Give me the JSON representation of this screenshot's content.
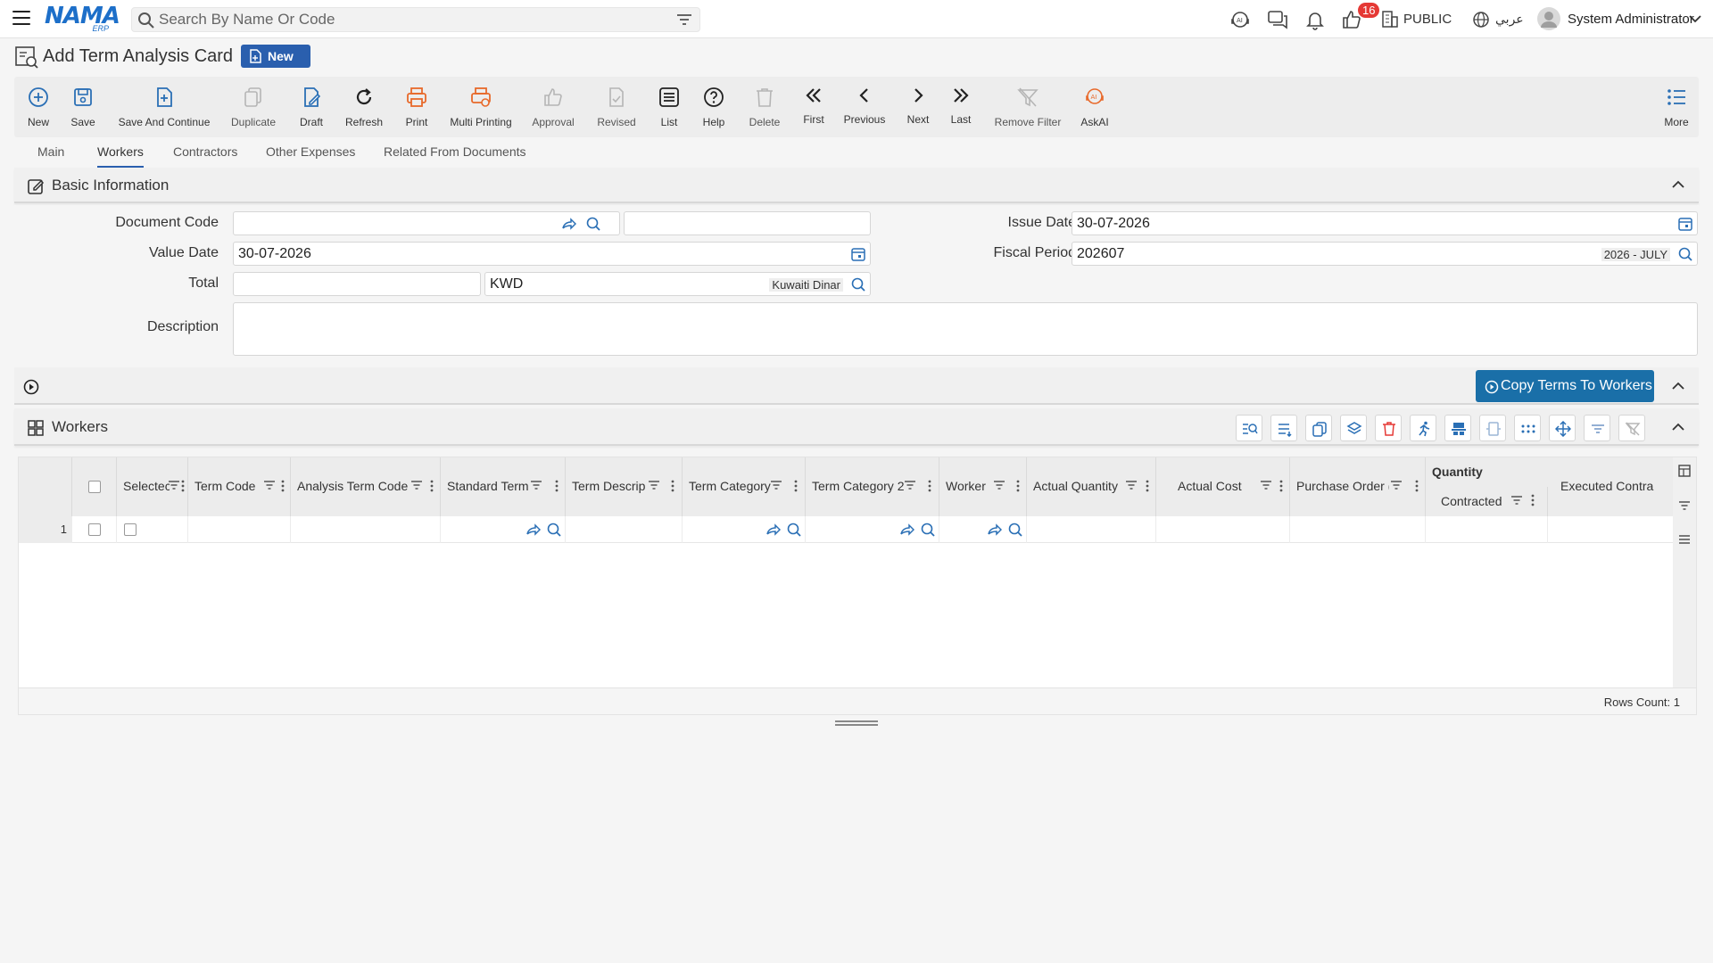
{
  "topbar": {
    "search_placeholder": "Search By Name Or Code",
    "logo_main": "NAMA",
    "logo_sub": "ERP",
    "notification_count": "16",
    "branch": "PUBLIC",
    "language": "عربي",
    "user_name": "System Administrator"
  },
  "page": {
    "title": "Add Term Analysis Card",
    "status_badge": "New"
  },
  "toolbar": [
    {
      "label": "New",
      "icon": "plus-circle-icon"
    },
    {
      "label": "Save",
      "icon": "save-icon"
    },
    {
      "label": "Save And Continue",
      "icon": "save-continue-icon"
    },
    {
      "label": "Duplicate",
      "icon": "duplicate-icon"
    },
    {
      "label": "Draft",
      "icon": "draft-icon"
    },
    {
      "label": "Refresh",
      "icon": "refresh-icon"
    },
    {
      "label": "Print",
      "icon": "print-icon"
    },
    {
      "label": "Multi Printing",
      "icon": "multi-print-icon"
    },
    {
      "label": "Approval",
      "icon": "thumbs-up-icon"
    },
    {
      "label": "Revised",
      "icon": "revised-icon"
    },
    {
      "label": "List",
      "icon": "list-icon"
    },
    {
      "label": "Help",
      "icon": "help-icon"
    },
    {
      "label": "Delete",
      "icon": "trash-icon"
    },
    {
      "label": "First",
      "icon": "first-icon"
    },
    {
      "label": "Previous",
      "icon": "previous-icon"
    },
    {
      "label": "Next",
      "icon": "next-icon"
    },
    {
      "label": "Last",
      "icon": "last-icon"
    },
    {
      "label": "Remove Filter",
      "icon": "remove-filter-icon"
    },
    {
      "label": "AskAI",
      "icon": "ai-icon"
    },
    {
      "label": "More",
      "icon": "more-list-icon"
    }
  ],
  "tabs": [
    {
      "label": "Main"
    },
    {
      "label": "Workers"
    },
    {
      "label": "Contractors"
    },
    {
      "label": "Other Expenses"
    },
    {
      "label": "Related From Documents"
    }
  ],
  "basic_info": {
    "title": "Basic Information",
    "document_code_label": "Document Code",
    "document_code_value": "",
    "value_date_label": "Value Date",
    "value_date_value": "30-07-2026",
    "total_label": "Total",
    "total_value": "",
    "currency_code": "KWD",
    "currency_name": "Kuwaiti Dinar",
    "issue_date_label": "Issue Date",
    "issue_date_value": "30-07-2026",
    "fiscal_period_label": "Fiscal Period",
    "fiscal_period_value": "202607",
    "fiscal_period_name": "2026 - JULY",
    "description_label": "Description",
    "description_value": ""
  },
  "copy_bar": {
    "button_label": "Copy Terms To Workers"
  },
  "workers": {
    "title": "Workers",
    "group_header": "Quantity",
    "columns": [
      "Selectec",
      "Term Code",
      "Analysis Term Code",
      "Standard Term",
      "Term Descrip",
      "Term Category",
      "Term Category 2",
      "Worker",
      "Actual Quantity",
      "Actual Cost",
      "Purchase Order (",
      "Contracted",
      "Executed Contra"
    ],
    "rows": [
      {
        "num": "1"
      }
    ],
    "rows_count_label": "Rows Count: 1"
  },
  "colors": {
    "accent": "#2a5fae",
    "copy_button": "#1a6fa8",
    "badge_red": "#e53935",
    "print_orange": "#e8692a"
  }
}
